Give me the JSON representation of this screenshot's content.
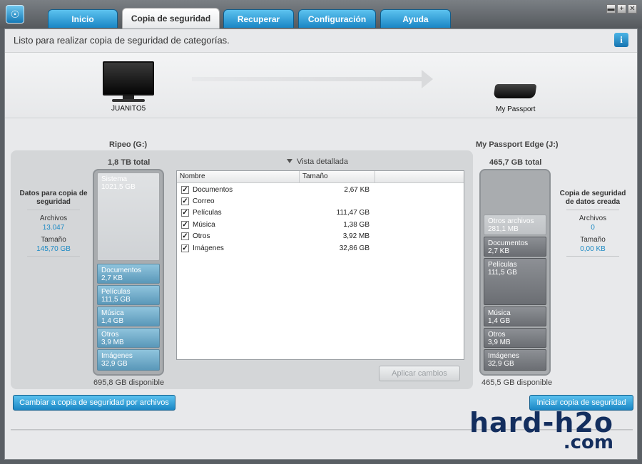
{
  "tabs": [
    {
      "label": "Inicio",
      "active": false
    },
    {
      "label": "Copia de seguridad",
      "active": true
    },
    {
      "label": "Recuperar",
      "active": false
    },
    {
      "label": "Configuración",
      "active": false
    },
    {
      "label": "Ayuda",
      "active": false
    }
  ],
  "window_controls": {
    "minimize": "▬",
    "maximize": "+",
    "close": "✕"
  },
  "status": "Listo para realizar copia de seguridad de categorías.",
  "info_icon": "i",
  "source_device": {
    "name": "JUANITO5",
    "icon": "monitor-icon"
  },
  "target_device": {
    "name": "My Passport",
    "icon": "passport-drive-icon"
  },
  "source_drive": {
    "title": "Ripeo (G:)",
    "total": "1,8 TB total",
    "available": "695,8 GB disponible",
    "segments": [
      {
        "name": "Sistema",
        "size": "1021,5 GB"
      },
      {
        "name": "Documentos",
        "size": "2,7 KB"
      },
      {
        "name": "Películas",
        "size": "111,5 GB"
      },
      {
        "name": "Música",
        "size": "1,4 GB"
      },
      {
        "name": "Otros",
        "size": "3,9 MB"
      },
      {
        "name": "Imágenes",
        "size": "32,9 GB"
      }
    ]
  },
  "target_drive": {
    "title": "My Passport Edge (J:)",
    "total": "465,7 GB total",
    "available": "465,5 GB disponible",
    "segments": [
      {
        "name": "Otros archivos",
        "size": "281,1 MB"
      },
      {
        "name": "Documentos",
        "size": "2,7 KB"
      },
      {
        "name": "Películas",
        "size": "111,5 GB"
      },
      {
        "name": "Música",
        "size": "1,4 GB"
      },
      {
        "name": "Otros",
        "size": "3,9 MB"
      },
      {
        "name": "Imágenes",
        "size": "32,9 GB"
      }
    ]
  },
  "left_stats": {
    "heading_line1": "Datos para copia de",
    "heading_line2": "seguridad",
    "files_label": "Archivos",
    "files_value": "13.047",
    "size_label": "Tamaño",
    "size_value": "145,70 GB"
  },
  "right_stats": {
    "heading_line1": "Copia de seguridad",
    "heading_line2": "de datos creada",
    "files_label": "Archivos",
    "files_value": "0",
    "size_label": "Tamaño",
    "size_value": "0,00 KB"
  },
  "view_toggle": "Vista detallada",
  "file_list": {
    "columns": [
      "Nombre",
      "Tamaño"
    ],
    "rows": [
      {
        "checked": true,
        "name": "Documentos",
        "size": "2,67 KB"
      },
      {
        "checked": true,
        "name": "Correo",
        "size": ""
      },
      {
        "checked": true,
        "name": "Películas",
        "size": "111,47 GB"
      },
      {
        "checked": true,
        "name": "Música",
        "size": "1,38 GB"
      },
      {
        "checked": true,
        "name": "Otros",
        "size": "3,92 MB"
      },
      {
        "checked": true,
        "name": "Imágenes",
        "size": "32,86 GB"
      }
    ]
  },
  "buttons": {
    "apply": "Aplicar cambios",
    "switch_mode": "Cambiar a copia de seguridad por archivos",
    "start_backup": "Iniciar copia de seguridad"
  },
  "watermark": {
    "line1": "hard-h2o",
    "line2": ".com"
  }
}
